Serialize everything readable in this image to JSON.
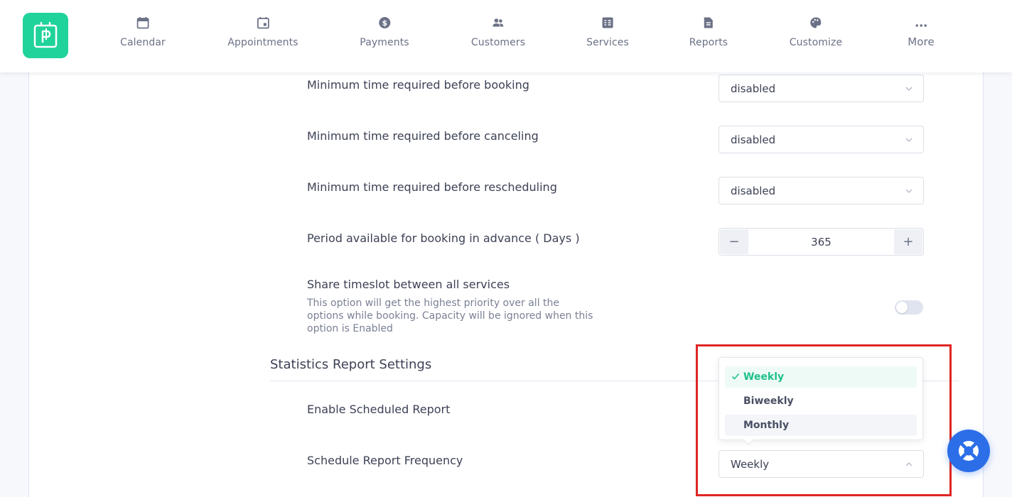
{
  "nav": {
    "items": [
      {
        "label": "Calendar",
        "icon": "calendar-icon"
      },
      {
        "label": "Appointments",
        "icon": "appointment-icon"
      },
      {
        "label": "Payments",
        "icon": "dollar-icon"
      },
      {
        "label": "Customers",
        "icon": "customers-icon"
      },
      {
        "label": "Services",
        "icon": "services-icon"
      },
      {
        "label": "Reports",
        "icon": "report-icon"
      },
      {
        "label": "Customize",
        "icon": "palette-icon"
      },
      {
        "label": "More",
        "icon": "more-icon"
      }
    ]
  },
  "settings": {
    "min_booking": {
      "label": "Minimum time required before booking",
      "value": "disabled"
    },
    "min_cancel": {
      "label": "Minimum time required before canceling",
      "value": "disabled"
    },
    "min_reschedule": {
      "label": "Minimum time required before rescheduling",
      "value": "disabled"
    },
    "period_advance": {
      "label": "Period available for booking in advance ( Days )",
      "value": "365",
      "minus": "−",
      "plus": "+"
    },
    "share_timeslot": {
      "label": "Share timeslot between all services",
      "description": "This option will get the highest priority over all the options while booking. Capacity will be ignored when this option is Enabled",
      "enabled": false
    }
  },
  "stats": {
    "title": "Statistics Report Settings",
    "enable_label": "Enable Scheduled Report",
    "frequency_label": "Schedule Report Frequency",
    "frequency_value": "Weekly",
    "options": [
      "Weekly",
      "Biweekly",
      "Monthly"
    ]
  },
  "colors": {
    "brand": "#1fd39a",
    "highlight": "#e02424",
    "help": "#2c6ee8"
  }
}
